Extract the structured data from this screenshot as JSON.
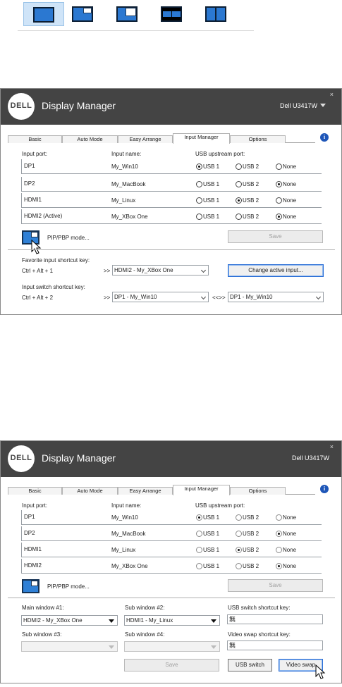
{
  "pip_modes": [
    {
      "name": "pip-mode-off-icon"
    },
    {
      "name": "pip-mode-top-right-icon"
    },
    {
      "name": "pip-mode-top-right-large-icon"
    },
    {
      "name": "pbp-mode-centered-icon"
    },
    {
      "name": "pbp-mode-split-icon"
    }
  ],
  "window1": {
    "close": "×",
    "logo": "DELL",
    "title": "Display Manager",
    "monitor": "Dell U3417W",
    "tabs": [
      "Basic",
      "Auto Mode",
      "Easy Arrange",
      "Input Manager",
      "Options"
    ],
    "active_tab": "Input Manager",
    "info": "i",
    "columns": {
      "port": "Input port:",
      "name": "Input name:",
      "usb": "USB upstream port:"
    },
    "radio_labels": [
      "USB 1",
      "USB 2",
      "None"
    ],
    "rows": [
      {
        "port": "DP1",
        "name": "My_Win10",
        "selected": "USB 1"
      },
      {
        "port": "DP2",
        "name": "My_MacBook",
        "selected": "None"
      },
      {
        "port": "HDMI1",
        "name": "My_Linux",
        "selected": "USB 2"
      },
      {
        "port": "HDMI2 (Active)",
        "name": "My_XBox One",
        "selected": "None"
      }
    ],
    "pip_label": "PIP/PBP mode...",
    "save": "Save",
    "favorite_label": "Favorite input shortcut key:",
    "favorite_keys": "Ctrl + Alt + 1",
    "favorite_arrow": ">>",
    "favorite_value": "HDMI2 - My_XBox One",
    "change_active": "Change active input...",
    "switch_label": "Input switch shortcut key:",
    "switch_keys": "Ctrl + Alt + 2",
    "switch_arrow": ">>",
    "switch_value_a": "DP1 - My_Win10",
    "switch_swap": "<<>>",
    "switch_value_b": "DP1 - My_Win10"
  },
  "window2": {
    "close": "×",
    "logo": "DELL",
    "title": "Display Manager",
    "monitor": "Dell U3417W",
    "tabs": [
      "Basic",
      "Auto Mode",
      "Easy Arrange",
      "Input Manager",
      "Options"
    ],
    "active_tab": "Input Manager",
    "info": "i",
    "columns": {
      "port": "Input port:",
      "name": "Input name:",
      "usb": "USB upstream port:"
    },
    "radio_labels": [
      "USB 1",
      "USB 2",
      "None"
    ],
    "rows": [
      {
        "port": "DP1",
        "name": "My_Win10",
        "selected": "USB 1"
      },
      {
        "port": "DP2",
        "name": "My_MacBook",
        "selected": "None"
      },
      {
        "port": "HDMI1",
        "name": "My_Linux",
        "selected": "USB 2"
      },
      {
        "port": "HDMI2",
        "name": "My_XBox One",
        "selected": "None"
      }
    ],
    "pip_label": "PIP/PBP mode...",
    "save": "Save",
    "main1_label": "Main window #1:",
    "main1_value": "HDMI2 - My_XBox One",
    "sub2_label": "Sub window #2:",
    "sub2_value": "HDMI1 - My_Linux",
    "usb_switch_label": "USB switch shortcut key:",
    "usb_switch_value": "無",
    "sub3_label": "Sub window #3:",
    "sub4_label": "Sub window #4:",
    "video_swap_label": "Video swap shortcut key:",
    "video_swap_value": "無",
    "save2": "Save",
    "usb_switch_button": "USB switch",
    "video_swap_button": "Video swap"
  }
}
